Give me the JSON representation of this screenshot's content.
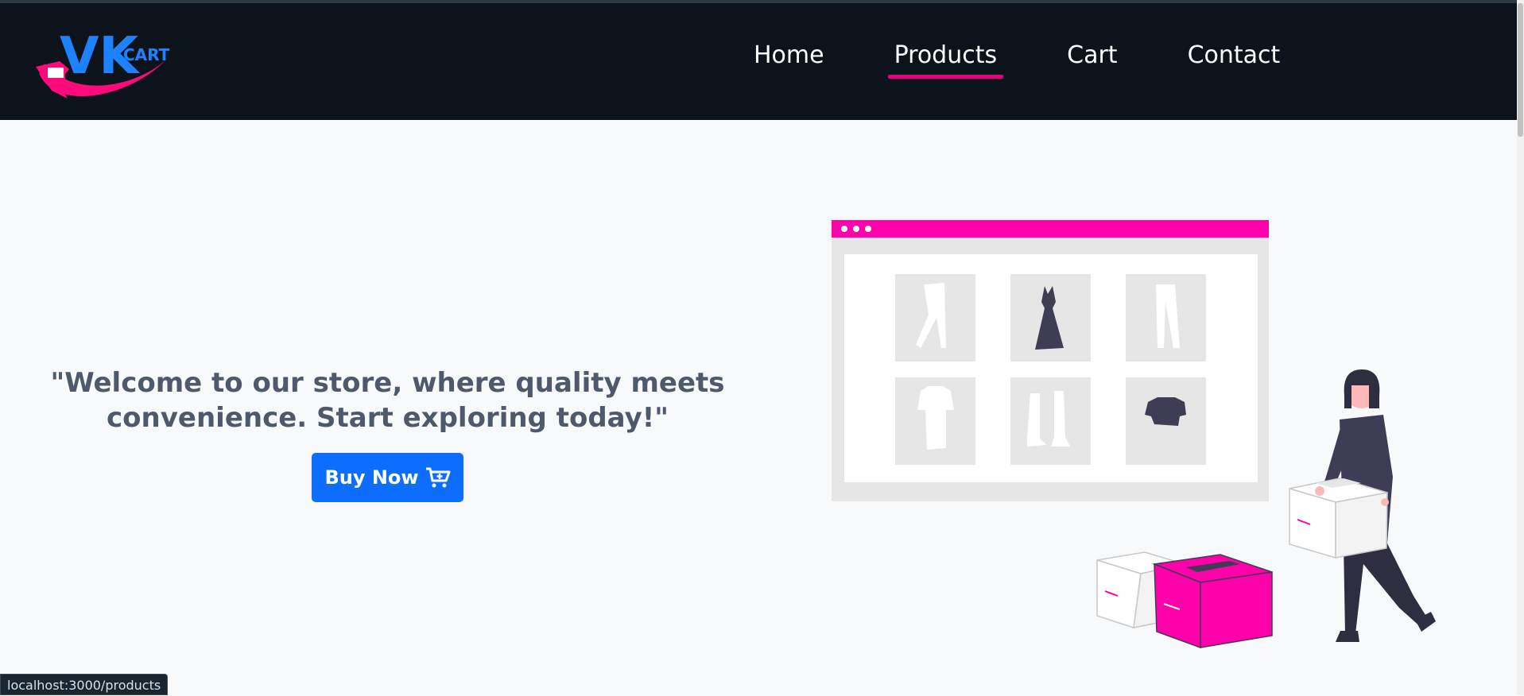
{
  "logo": {
    "mark": "VK",
    "subtext": "CART"
  },
  "nav": {
    "items": [
      {
        "label": "Home",
        "active": false
      },
      {
        "label": "Products",
        "active": true
      },
      {
        "label": "Cart",
        "active": false
      },
      {
        "label": "Contact",
        "active": false
      }
    ]
  },
  "hero": {
    "tagline": "\"Welcome to our store, where quality meets convenience. Start exploring today!\"",
    "buy_label": "Buy Now"
  },
  "status": {
    "url": "localhost:3000/products"
  },
  "colors": {
    "accent": "#e6007e",
    "illustration_pink": "#ff00aa",
    "button": "#0d6efd",
    "navbar": "#0d131b",
    "text": "#4e596b"
  },
  "icons": {
    "cart": "cart-plus-icon",
    "logo_cart": "shopping-cart-icon"
  }
}
